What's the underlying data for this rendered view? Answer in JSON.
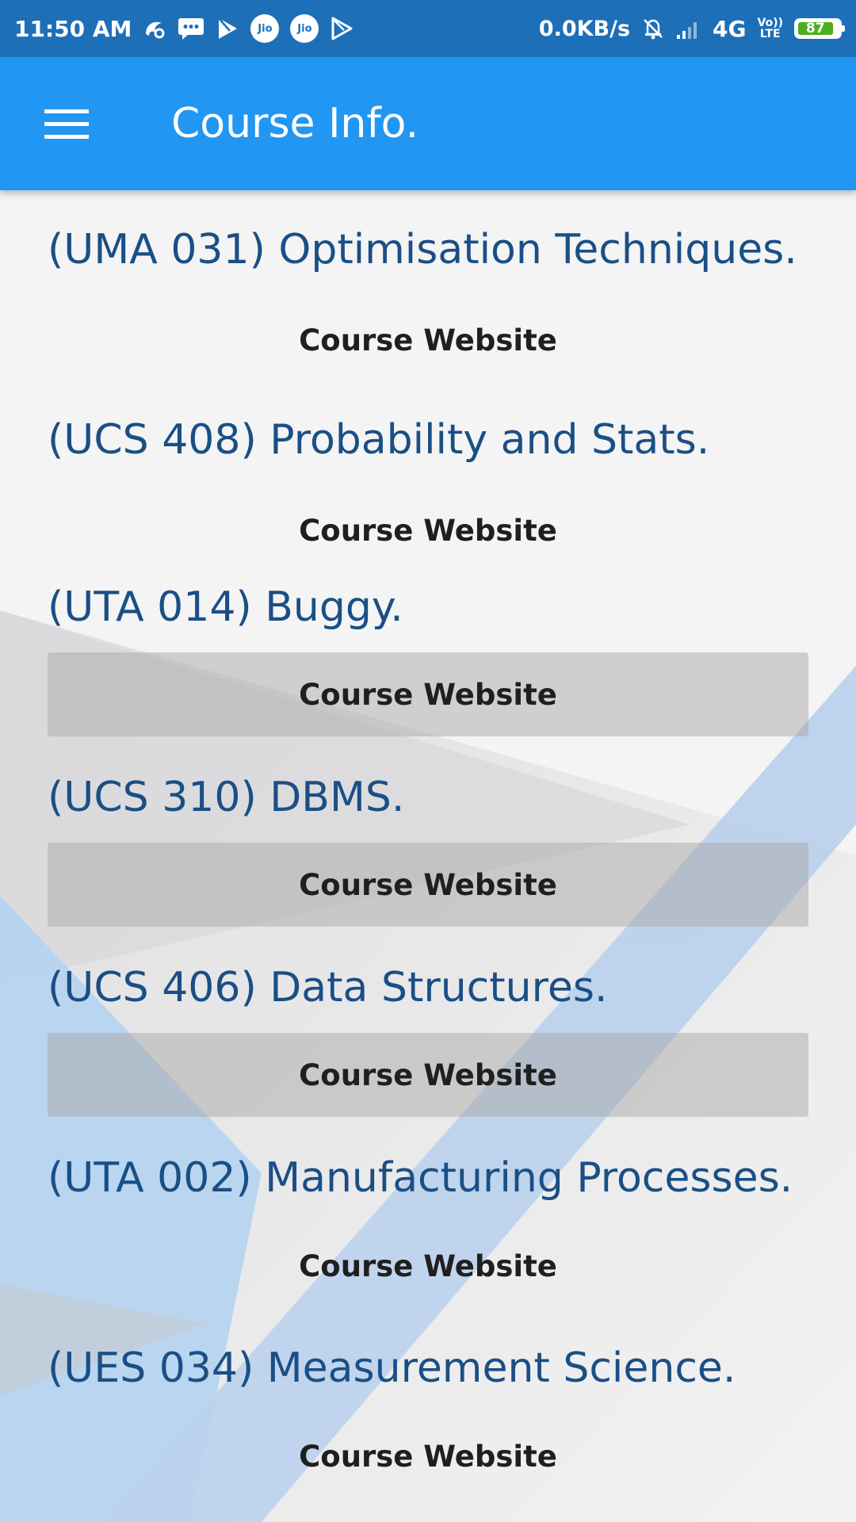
{
  "status_bar": {
    "time": "11:50 AM",
    "jio_labels": [
      "Jio",
      "Jio"
    ],
    "net_speed": "0.0KB/s",
    "network": "4G",
    "volte_lines": [
      "Vo))",
      "LTE"
    ],
    "battery": "87",
    "icons": [
      "uc-browser-icon",
      "messages-icon",
      "play-store-icon",
      "jio-icon",
      "jio-icon",
      "play-store-icon",
      "mute-bell-icon",
      "signal-icon",
      "volte-icon",
      "battery-icon"
    ]
  },
  "app_bar": {
    "title": "Course Info.",
    "menu_icon": "hamburger-menu-icon"
  },
  "colors": {
    "status_bar": "#1d6fb8",
    "app_bar": "#2196f3",
    "title_text": "#1a4f85",
    "background": "#f4f4f5",
    "battery_fill": "#4caf1f"
  },
  "courses": [
    {
      "title": "(UMA 031) Optimisation Techniques.",
      "button_label": "Course Website"
    },
    {
      "title": "(UCS 408) Probability and Stats.",
      "button_label": "Course Website"
    },
    {
      "title": "(UTA 014) Buggy.",
      "button_label": "Course Website"
    },
    {
      "title": "(UCS 310) DBMS.",
      "button_label": "Course Website"
    },
    {
      "title": "(UCS 406) Data Structures.",
      "button_label": "Course Website"
    },
    {
      "title": "(UTA 002) Manufacturing Processes.",
      "button_label": "Course Website"
    },
    {
      "title": "(UES 034) Measurement Science.",
      "button_label": "Course Website"
    }
  ]
}
